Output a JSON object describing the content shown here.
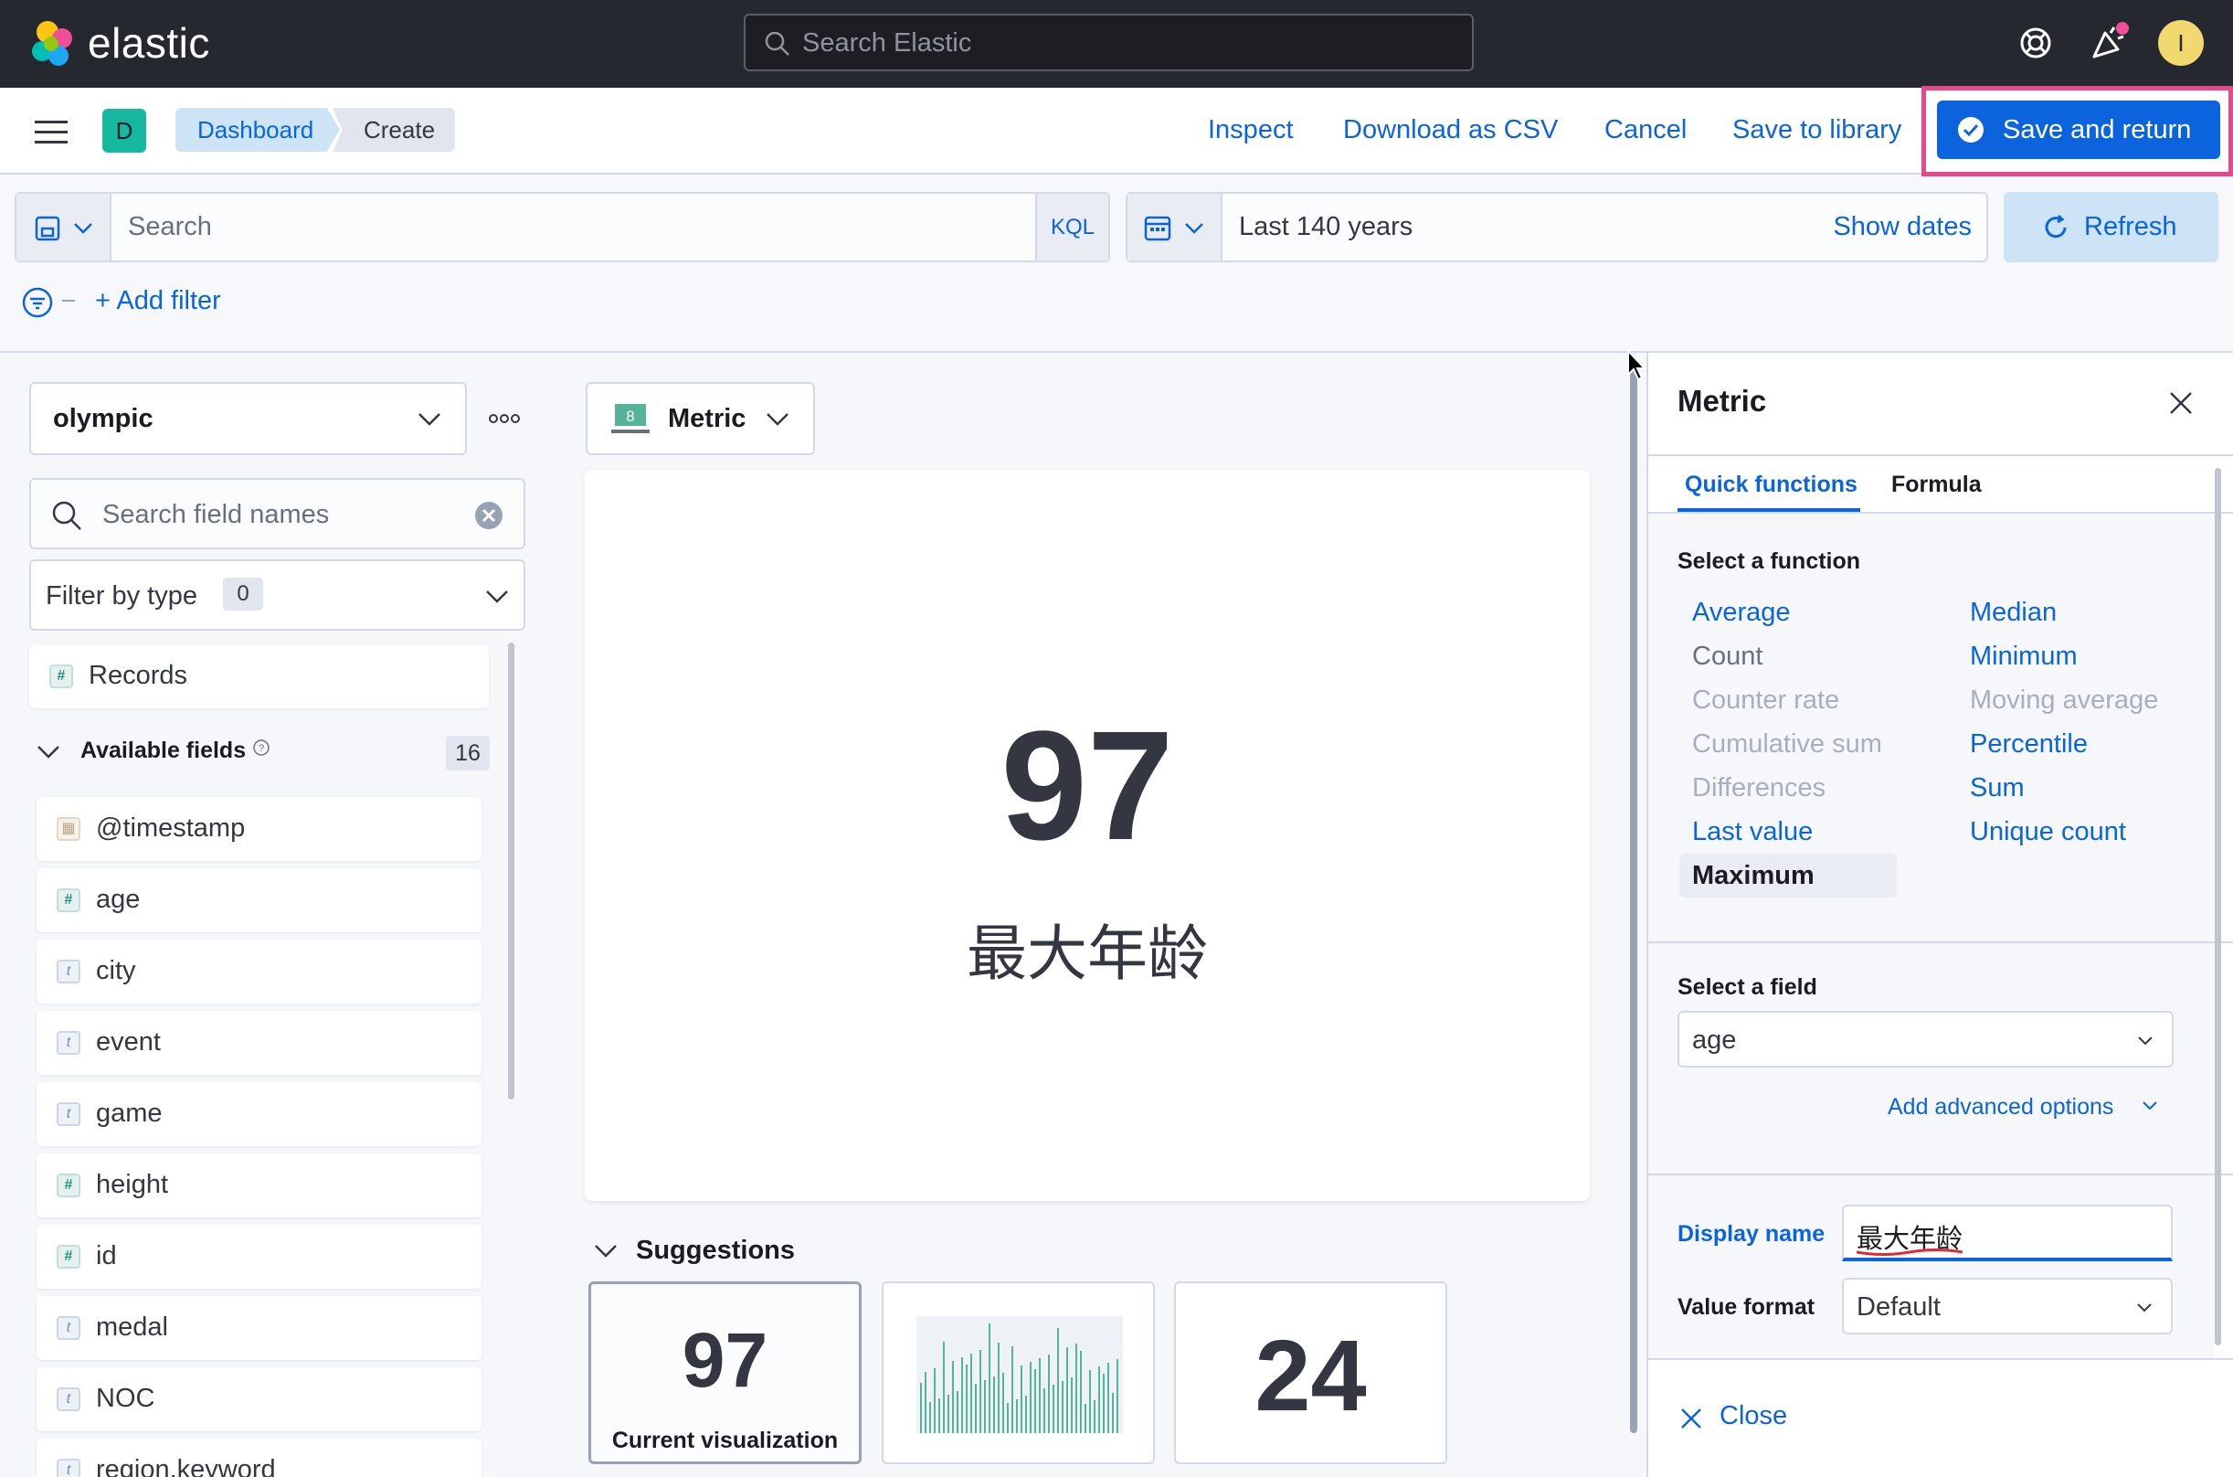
{
  "header": {
    "logo_text": "elastic",
    "search_placeholder": "Search Elastic",
    "avatar_initial": "I"
  },
  "appbar": {
    "space_initial": "D",
    "breadcrumbs": [
      "Dashboard",
      "Create"
    ],
    "links": {
      "inspect": "Inspect",
      "download_csv": "Download as CSV",
      "cancel": "Cancel",
      "save_to_library": "Save to library"
    },
    "save_and_return": "Save and return"
  },
  "querybar": {
    "search_placeholder": "Search",
    "language": "KQL",
    "date_range": "Last 140 years",
    "show_dates": "Show dates",
    "refresh": "Refresh",
    "add_filter": "+ Add filter"
  },
  "sidebar": {
    "data_view": "olympic",
    "field_search_placeholder": "Search field names",
    "filter_by_type": "Filter by type",
    "filter_count": "0",
    "records": "Records",
    "available_fields_label": "Available fields",
    "available_fields_count": "16",
    "fields": [
      {
        "name": "@timestamp",
        "type": "date"
      },
      {
        "name": "age",
        "type": "number"
      },
      {
        "name": "city",
        "type": "string"
      },
      {
        "name": "event",
        "type": "string"
      },
      {
        "name": "game",
        "type": "string"
      },
      {
        "name": "height",
        "type": "number"
      },
      {
        "name": "id",
        "type": "number"
      },
      {
        "name": "medal",
        "type": "string"
      },
      {
        "name": "NOC",
        "type": "string"
      },
      {
        "name": "region.keyword",
        "type": "string"
      }
    ]
  },
  "workspace": {
    "vis_type": "Metric",
    "metric_value": "97",
    "metric_label": "最大年龄",
    "suggestions_title": "Suggestions",
    "suggestions": [
      {
        "value": "97",
        "caption": "Current visualization"
      },
      {
        "value": "",
        "caption": ""
      },
      {
        "value": "24",
        "caption": ""
      }
    ]
  },
  "flyout": {
    "title": "Metric",
    "tabs": [
      "Quick functions",
      "Formula"
    ],
    "select_function_label": "Select a function",
    "functions_left": [
      {
        "label": "Average",
        "state": "on"
      },
      {
        "label": "Count",
        "state": "dark"
      },
      {
        "label": "Counter rate",
        "state": "off"
      },
      {
        "label": "Cumulative sum",
        "state": "off"
      },
      {
        "label": "Differences",
        "state": "off"
      },
      {
        "label": "Last value",
        "state": "on"
      },
      {
        "label": "Maximum",
        "state": "sel"
      }
    ],
    "functions_right": [
      {
        "label": "Median",
        "state": "on"
      },
      {
        "label": "Minimum",
        "state": "on"
      },
      {
        "label": "Moving average",
        "state": "off"
      },
      {
        "label": "Percentile",
        "state": "on"
      },
      {
        "label": "Sum",
        "state": "on"
      },
      {
        "label": "Unique count",
        "state": "on"
      }
    ],
    "select_field_label": "Select a field",
    "selected_field": "age",
    "add_advanced": "Add advanced options",
    "display_name_label": "Display name",
    "display_name_value": "最大年龄",
    "value_format_label": "Value format",
    "value_format": "Default",
    "close": "Close"
  }
}
